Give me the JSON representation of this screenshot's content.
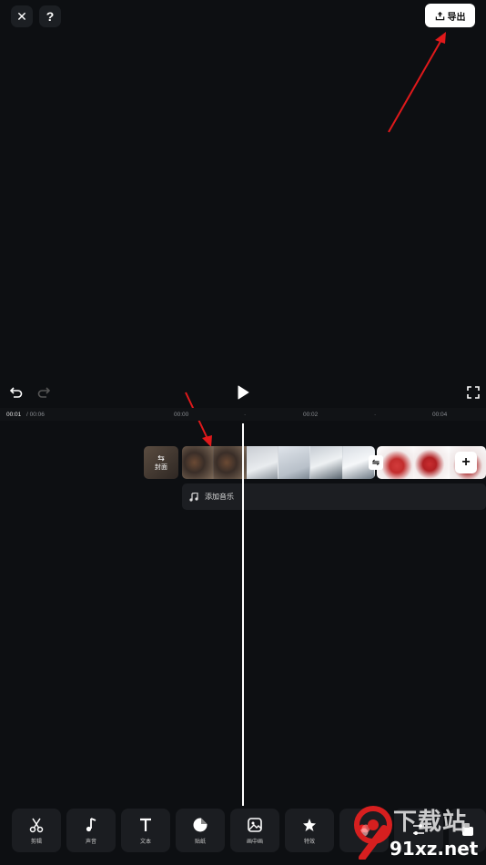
{
  "header": {
    "close_label": "✕",
    "help_label": "?",
    "export_label": "导出"
  },
  "timeline": {
    "current_time": "00:01",
    "total_time": "/ 00:06",
    "marks": [
      "00:00",
      "00:02",
      "00:04"
    ]
  },
  "track": {
    "cover_label": "封面",
    "transition_label": "⇋",
    "add_clip_label": "+"
  },
  "music": {
    "label": "添加音乐"
  },
  "toolbar": {
    "items": [
      {
        "label": "剪辑",
        "icon": "scissors-icon"
      },
      {
        "label": "声音",
        "icon": "music-note-icon"
      },
      {
        "label": "文本",
        "icon": "text-icon"
      },
      {
        "label": "贴纸",
        "icon": "sticker-icon"
      },
      {
        "label": "画中画",
        "icon": "picture-in-picture-icon"
      },
      {
        "label": "特效",
        "icon": "effects-star-icon"
      },
      {
        "label": "",
        "icon": "filter-icon"
      },
      {
        "label": "",
        "icon": "adjust-icon"
      },
      {
        "label": "",
        "icon": "more-icon"
      }
    ]
  },
  "watermark": {
    "logo_text": "下载站",
    "url_text": "91xz.net"
  },
  "colors": {
    "background": "#0d0f12",
    "annotation_arrow": "#e0191b",
    "export_button": "#ffffff"
  }
}
